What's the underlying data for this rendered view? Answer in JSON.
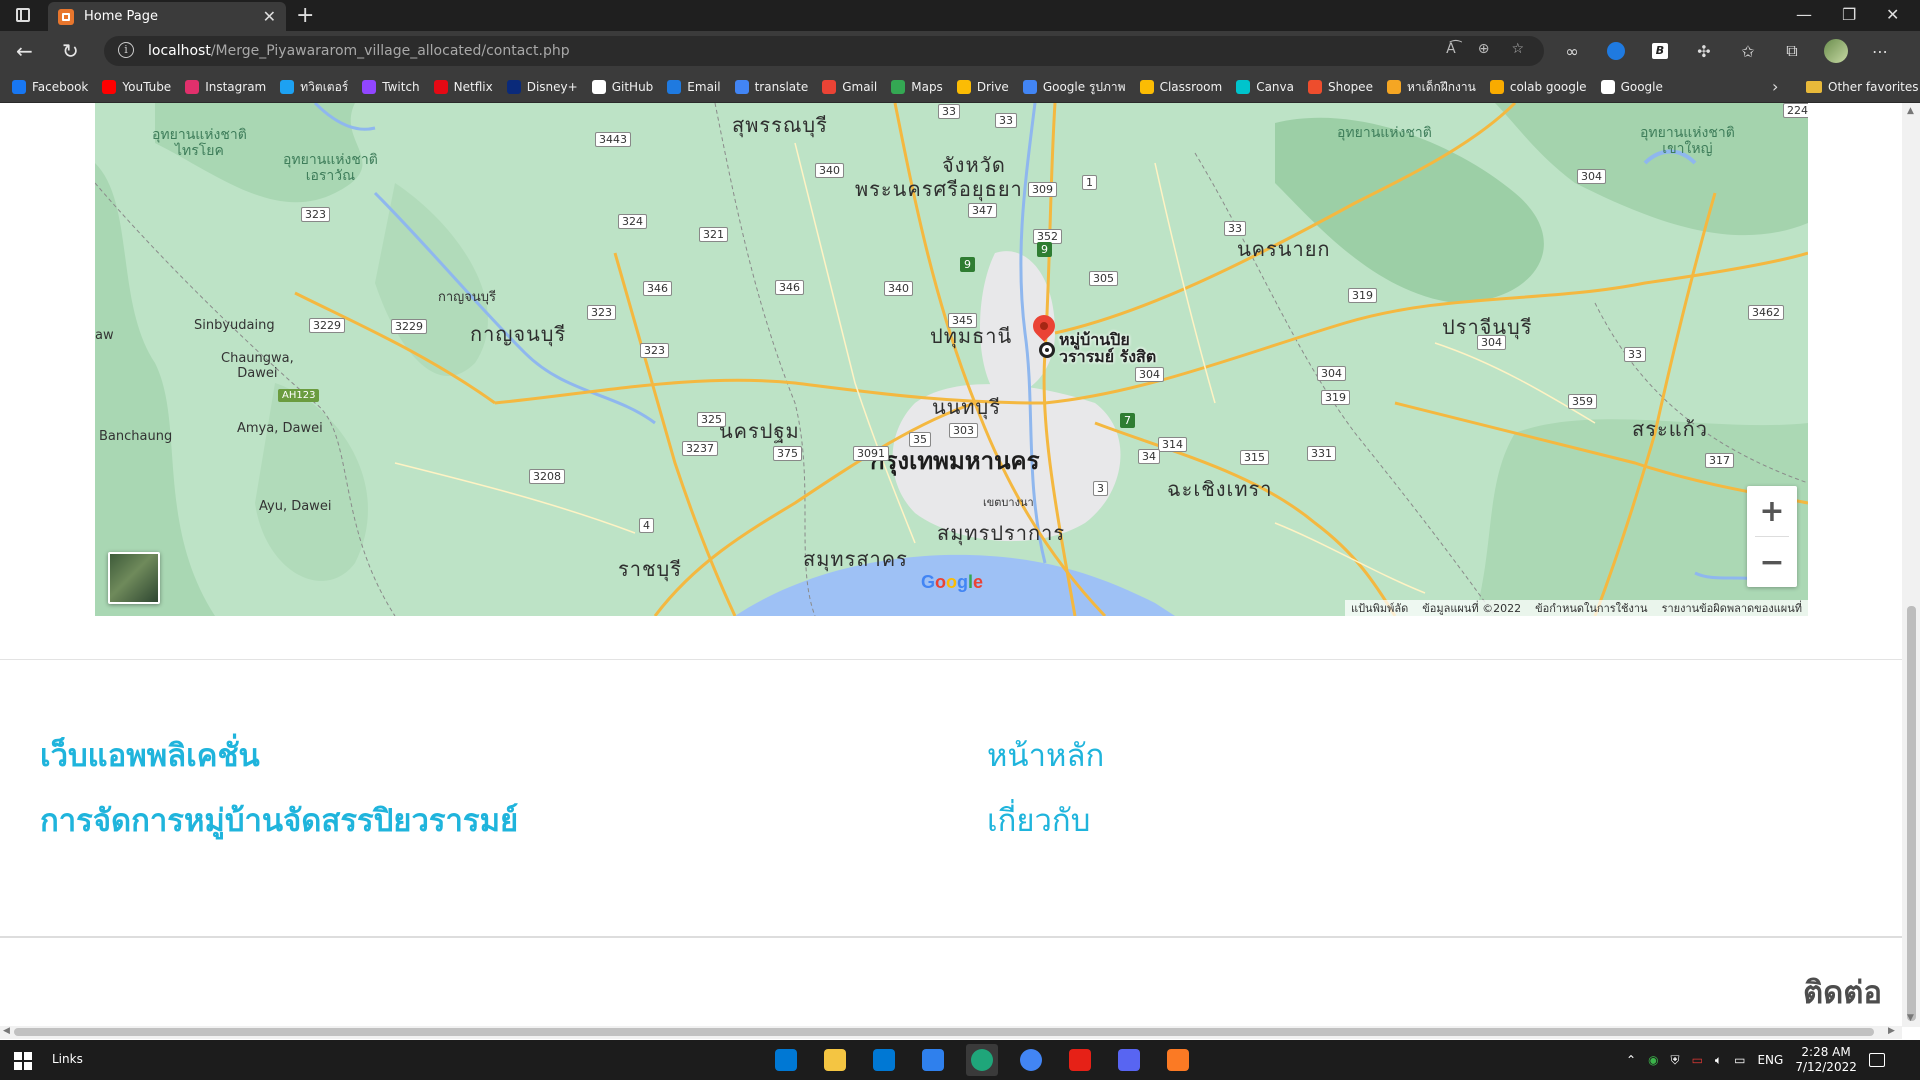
{
  "browser": {
    "tab_title": "Home Page",
    "url_host": "localhost",
    "url_path": "/Merge_Piyawararom_village_allocated/contact.php",
    "bookmarks": [
      "Facebook",
      "YouTube",
      "Instagram",
      "ทวิตเตอร์",
      "Twitch",
      "Netflix",
      "Disney+",
      "GitHub",
      "Email",
      "translate",
      "Gmail",
      "Maps",
      "Drive",
      "Google รูปภาพ",
      "Classroom",
      "Canva",
      "Shopee",
      "หาเด็กฝึกงาน",
      "colab google",
      "Google"
    ],
    "bookmark_colors": [
      "#1877f2",
      "#ff0000",
      "#e1306c",
      "#1da1f2",
      "#9146ff",
      "#e50914",
      "#0a2a7a",
      "#ffffff",
      "#1f7ae0",
      "#4285f4",
      "#ea4335",
      "#34a853",
      "#fbbc04",
      "#4285f4",
      "#fbbc04",
      "#00c4cc",
      "#ee4d2d",
      "#f5a623",
      "#f9ab00",
      "#ffffff"
    ],
    "other_favorites": "Other favorites"
  },
  "map": {
    "labels": {
      "province_bkk": "กรุงเทพมหานคร",
      "ayutthaya_1": "จังหวัด",
      "ayutthaya_2": "พระนครศรีอยุธยา",
      "suphanburi": "สุพรรณบุรี",
      "pathumthani": "ปทุมธานี",
      "nonthaburi": "นนทบุรี",
      "nakhonpathom": "นครปฐม",
      "kanchanaburi": "กาญจนบุรี",
      "kanchanaburi_town": "กาญจนบุรี",
      "nakhonnayok": "นครนายก",
      "prachinburi": "ปราจีนบุรี",
      "sakaeo": "สระแก้ว",
      "chachoengsao": "ฉะเชิงเทรา",
      "samutprakan": "สมุทรปราการ",
      "samutsakhon": "สมุทรสาคร",
      "ratchaburi": "ราชบุรี",
      "bangna": "เขตบางนา",
      "park_saiyok_1": "อุทยานแห่งชาติ",
      "park_saiyok_2": "ไทรโยค",
      "park_erawan_1": "อุทยานแห่งชาติ",
      "park_erawan_2": "เอราวัณ",
      "park_khaoyai_1": "อุทยานแห่งชาติ",
      "park_khaoyai_2": "เขาใหญ่",
      "sinbyudaing": "Sinbyudaing",
      "chaungwa_1": "Chaungwa,",
      "chaungwa_2": "Dawei",
      "banchaung": "Banchaung",
      "amya": "Amya, Dawei",
      "ayu": "Ayu, Dawei",
      "aw": "aw",
      "place_1": "หมู่บ้านปิย",
      "place_2": "วรารมย์ รังสิต"
    },
    "routes": [
      "33",
      "33",
      "3443",
      "340",
      "323",
      "324",
      "321",
      "346",
      "346",
      "340",
      "347",
      "309",
      "1",
      "352",
      "9",
      "9",
      "305",
      "345",
      "3229",
      "3229",
      "323",
      "323",
      "304",
      "33",
      "319",
      "304",
      "33",
      "3462",
      "304",
      "304",
      "319",
      "359",
      "325",
      "3237",
      "375",
      "3091",
      "303",
      "35",
      "7",
      "314",
      "315",
      "331",
      "34",
      "3",
      "3208",
      "4",
      "224",
      "317"
    ],
    "zoom_in": "+",
    "zoom_out": "−",
    "google_logo": "Google",
    "footer": [
      "แป้นพิมพ์ลัด",
      "ข้อมูลแผนที่ ©2022",
      "ข้อกำหนดในการใช้งาน",
      "รายงานข้อผิดพลาดของแผนที่"
    ]
  },
  "footer": {
    "title_1": "เว็บแอพพลิเคชั่น",
    "title_2": "การจัดการหมู่บ้านจัดสรรปิยวรารมย์",
    "link_home": "หน้าหลัก",
    "link_about": "เกี่ยวกับ",
    "contact": "ติดต่อ"
  },
  "taskbar": {
    "links": "Links",
    "apps": [
      "Microsoft Store",
      "File Explorer",
      "Mail",
      "Visual Studio Code",
      "Microsoft Edge",
      "Google Chrome",
      "YouTube Music",
      "Discord",
      "XAMPP"
    ],
    "app_colors": [
      "#0078d4",
      "#f4c542",
      "#0078d4",
      "#2f80ed",
      "#1fa67a",
      "#4285f4",
      "#e62117",
      "#5865f2",
      "#fb7a24"
    ],
    "lang": "ENG",
    "time": "2:28 AM",
    "date": "7/12/2022"
  }
}
